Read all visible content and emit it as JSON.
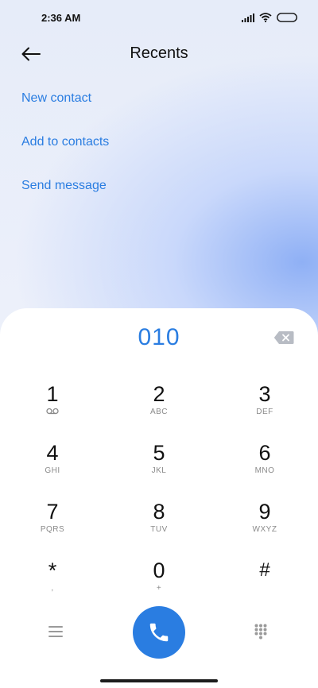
{
  "status_bar": {
    "time": "2:36 AM",
    "icons": [
      "signal-icon",
      "wifi-icon",
      "battery-icon"
    ]
  },
  "header": {
    "title": "Recents",
    "back_icon": "arrow-left-icon"
  },
  "actions": [
    {
      "label": "New contact"
    },
    {
      "label": "Add to contacts"
    },
    {
      "label": "Send message"
    }
  ],
  "dialpad": {
    "number": "010",
    "keys": [
      {
        "digit": "1",
        "letters": "voicemail-icon"
      },
      {
        "digit": "2",
        "letters": "ABC"
      },
      {
        "digit": "3",
        "letters": "DEF"
      },
      {
        "digit": "4",
        "letters": "GHI"
      },
      {
        "digit": "5",
        "letters": "JKL"
      },
      {
        "digit": "6",
        "letters": "MNO"
      },
      {
        "digit": "7",
        "letters": "PQRS"
      },
      {
        "digit": "8",
        "letters": "TUV"
      },
      {
        "digit": "9",
        "letters": "WXYZ"
      },
      {
        "digit": "*",
        "letters": ","
      },
      {
        "digit": "0",
        "letters": "+"
      },
      {
        "digit": "#",
        "letters": ""
      }
    ]
  },
  "colors": {
    "accent": "#2a7de1"
  }
}
